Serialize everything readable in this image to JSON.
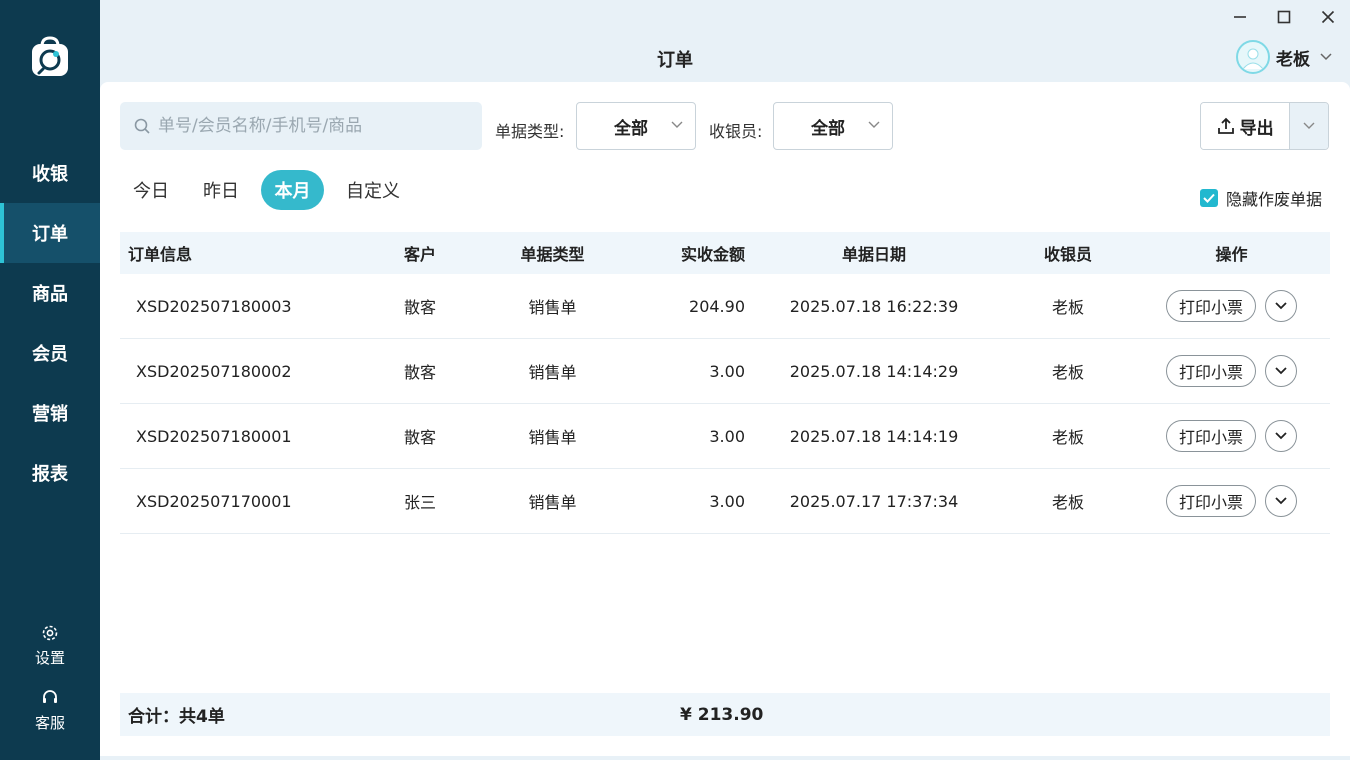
{
  "sidebar": {
    "items": [
      {
        "label": "收银",
        "active": false
      },
      {
        "label": "订单",
        "active": true
      },
      {
        "label": "商品",
        "active": false
      },
      {
        "label": "会员",
        "active": false
      },
      {
        "label": "营销",
        "active": false
      },
      {
        "label": "报表",
        "active": false
      }
    ],
    "settings_label": "设置",
    "service_label": "客服"
  },
  "header": {
    "title": "订单",
    "user_name": "老板"
  },
  "toolbar": {
    "search_placeholder": "单号/会员名称/手机号/商品",
    "type_label": "单据类型:",
    "type_value": "全部",
    "cashier_label": "收银员:",
    "cashier_value": "全部",
    "export_label": "导出"
  },
  "range_tabs": [
    {
      "label": "今日",
      "active": false
    },
    {
      "label": "昨日",
      "active": false
    },
    {
      "label": "本月",
      "active": true
    },
    {
      "label": "自定义",
      "active": false
    }
  ],
  "hide_void": {
    "label": "隐藏作废单据",
    "checked": true
  },
  "table": {
    "headers": {
      "id": "订单信息",
      "customer": "客户",
      "type": "单据类型",
      "amount": "实收金额",
      "date": "单据日期",
      "cashier": "收银员",
      "ops": "操作"
    },
    "print_label": "打印小票",
    "rows": [
      {
        "id": "XSD202507180003",
        "customer": "散客",
        "type": "销售单",
        "amount": "204.90",
        "date": "2025.07.18 16:22:39",
        "cashier": "老板"
      },
      {
        "id": "XSD202507180002",
        "customer": "散客",
        "type": "销售单",
        "amount": "3.00",
        "date": "2025.07.18 14:14:29",
        "cashier": "老板"
      },
      {
        "id": "XSD202507180001",
        "customer": "散客",
        "type": "销售单",
        "amount": "3.00",
        "date": "2025.07.18 14:14:19",
        "cashier": "老板"
      },
      {
        "id": "XSD202507170001",
        "customer": "张三",
        "type": "销售单",
        "amount": "3.00",
        "date": "2025.07.17 17:37:34",
        "cashier": "老板"
      }
    ]
  },
  "summary": {
    "count_text": "合计：共4单",
    "total_text": "¥ 213.90"
  },
  "colors": {
    "sidebar_bg": "#0d3a4f",
    "accent": "#35b9cc",
    "header_bg": "#e8f1f7"
  }
}
